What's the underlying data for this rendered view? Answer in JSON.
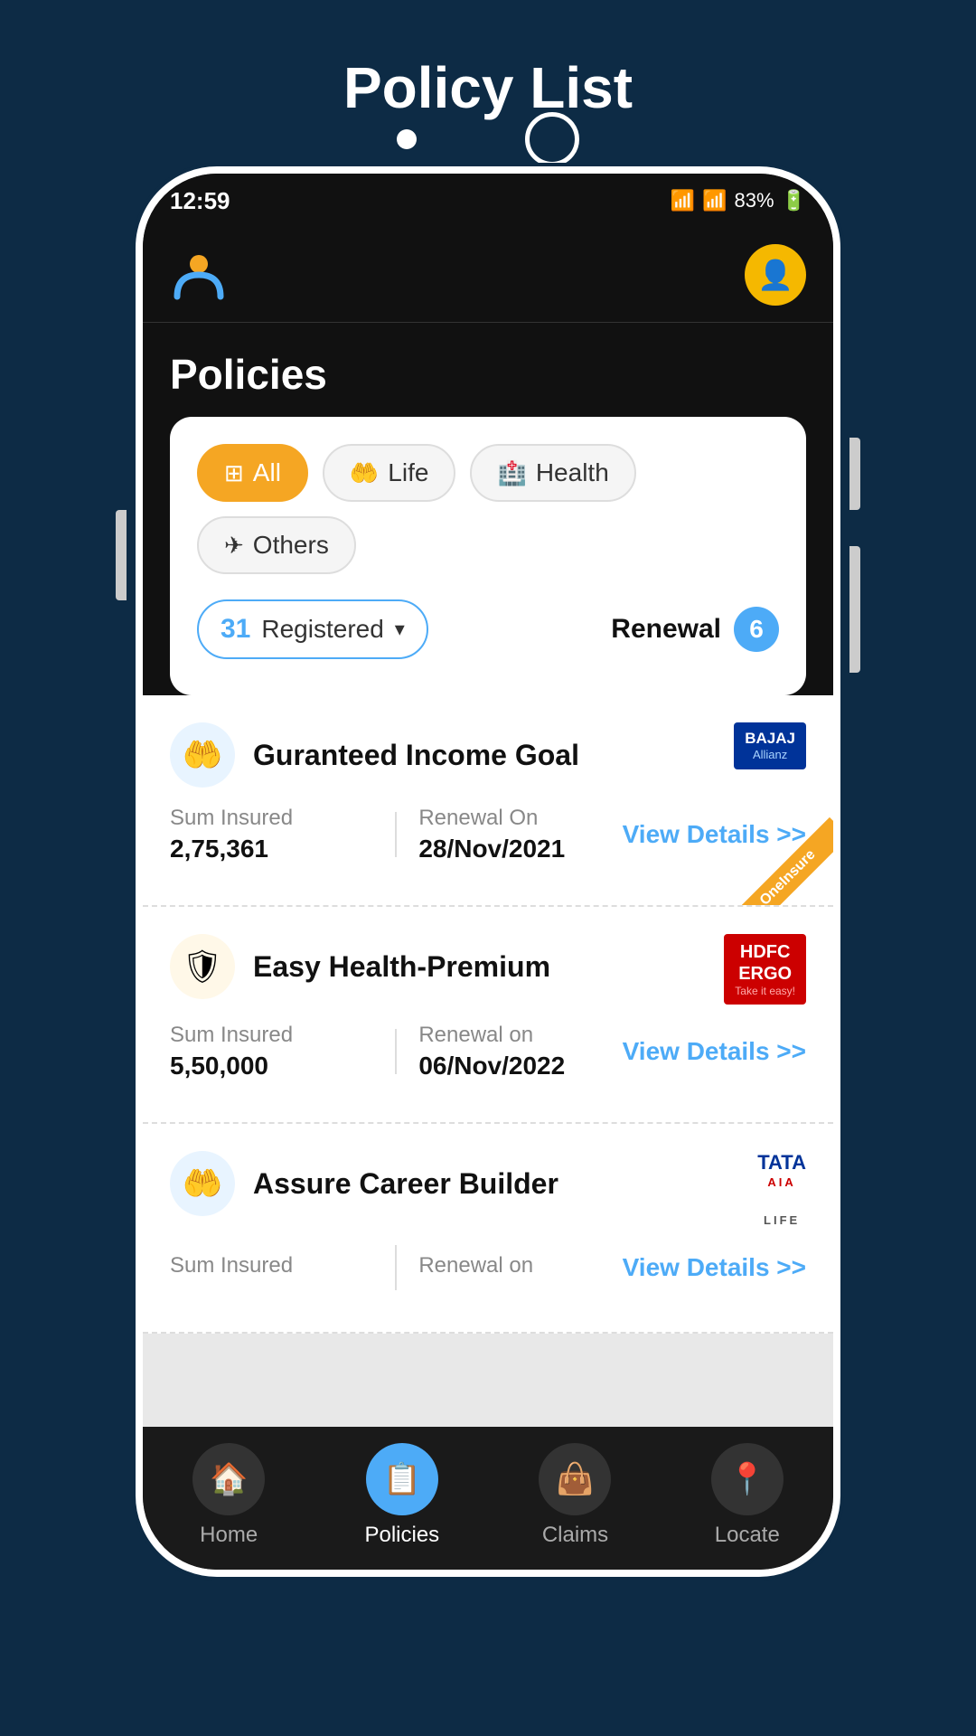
{
  "page": {
    "title": "Policy List",
    "background_color": "#0d2b45"
  },
  "status_bar": {
    "time": "12:59",
    "battery": "83%",
    "wifi_icon": "wifi",
    "signal_icon": "signal",
    "battery_icon": "battery"
  },
  "header": {
    "logo_alt": "OneInsure Logo",
    "avatar_icon": "👤"
  },
  "policies": {
    "heading": "Policies",
    "filter_tabs": [
      {
        "label": "All",
        "icon": "⊞",
        "active": true
      },
      {
        "label": "Life",
        "icon": "🤲",
        "active": false
      },
      {
        "label": "Health",
        "icon": "🏥",
        "active": false
      },
      {
        "label": "Others",
        "icon": "✈",
        "active": false
      }
    ],
    "registered_count": "31",
    "registered_label": "Registered",
    "renewal_label": "Renewal",
    "renewal_count": "6",
    "items": [
      {
        "name": "Guranteed Income Goal",
        "insurer": "BAJAJ Allianz",
        "insurer_type": "bajaj",
        "icon": "🤲",
        "icon_color": "#e8f4ff",
        "sum_insured_label": "Sum Insured",
        "sum_insured": "2,75,361",
        "renewal_on_label": "Renewal On",
        "renewal_on": "28/Nov/2021",
        "view_details": "View Details >>",
        "has_ribbon": true
      },
      {
        "name": "Easy Health-Premium",
        "insurer": "HDFC ERGO",
        "insurer_type": "hdfc",
        "icon": "🛡",
        "icon_color": "#fff8e8",
        "sum_insured_label": "Sum Insured",
        "sum_insured": "5,50,000",
        "renewal_on_label": "Renewal on",
        "renewal_on": "06/Nov/2022",
        "view_details": "View Details >>",
        "has_ribbon": false
      },
      {
        "name": "Assure Career Builder",
        "insurer": "TATA AIA LIFE",
        "insurer_type": "tata",
        "icon": "🤲",
        "icon_color": "#e8f4ff",
        "sum_insured_label": "Sum Insured",
        "sum_insured": "",
        "renewal_on_label": "Renewal on",
        "renewal_on": "",
        "view_details": "View Details >>",
        "has_ribbon": false
      }
    ]
  },
  "bottom_nav": {
    "items": [
      {
        "label": "Home",
        "icon": "🏠",
        "active": false
      },
      {
        "label": "Policies",
        "icon": "📋",
        "active": true
      },
      {
        "label": "Claims",
        "icon": "👜",
        "active": false
      },
      {
        "label": "Locate",
        "icon": "📍",
        "active": false
      }
    ]
  }
}
